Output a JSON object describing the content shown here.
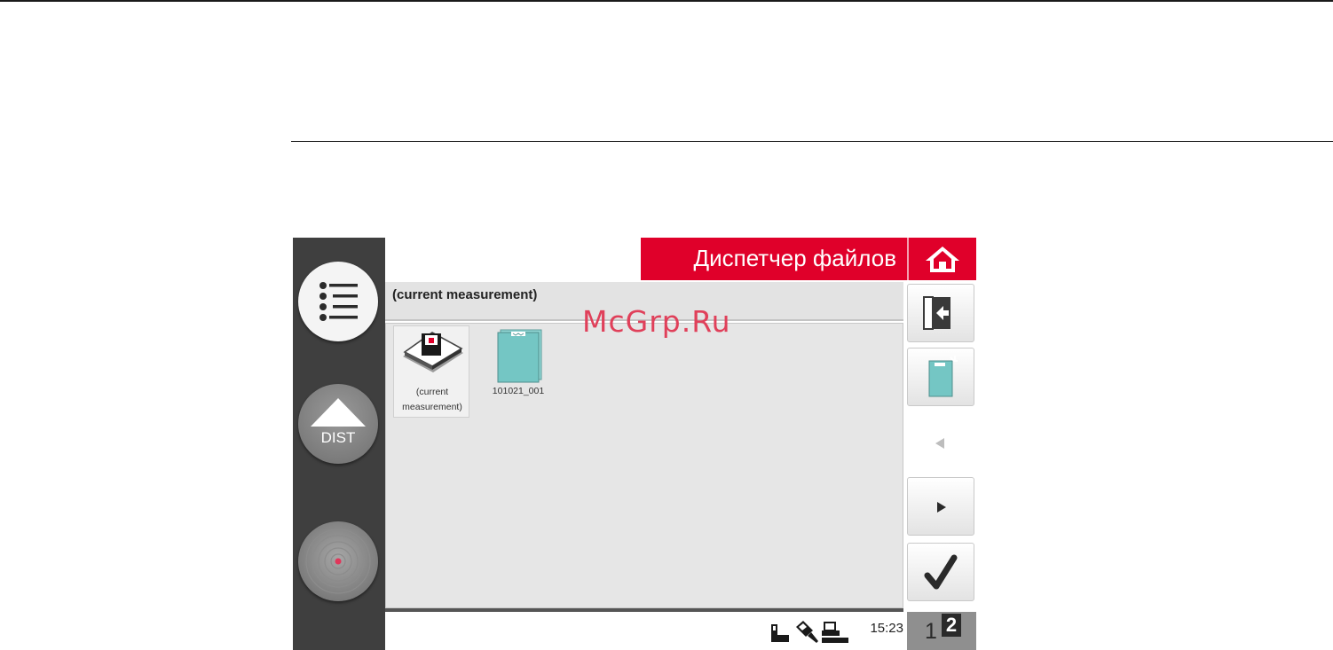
{
  "header": {
    "title": "Диспетчер файлов"
  },
  "path": {
    "current": "(current measurement)"
  },
  "files": [
    {
      "label_line1": "(current",
      "label_line2": "measurement)",
      "selected": true
    },
    {
      "label_line1": "101021_001",
      "label_line2": "",
      "selected": false
    }
  ],
  "left_bar": {
    "dist_label": "DIST"
  },
  "status": {
    "time": "15:23"
  },
  "pager": {
    "page1": "1",
    "page2": "2"
  },
  "watermark": "McGrp.Ru",
  "colors": {
    "accent": "#e0002a",
    "file_teal": "#74c6c4",
    "side_dark": "#3f3f3f",
    "target_dot": "#e0365a"
  },
  "icons": [
    "list-menu-icon",
    "dist-arrow-icon",
    "target-icon",
    "home-icon",
    "exit-door-icon",
    "new-file-icon",
    "prev-page-icon",
    "next-page-icon",
    "confirm-check-icon",
    "storage-icon",
    "probe-icon",
    "printer-icon"
  ]
}
